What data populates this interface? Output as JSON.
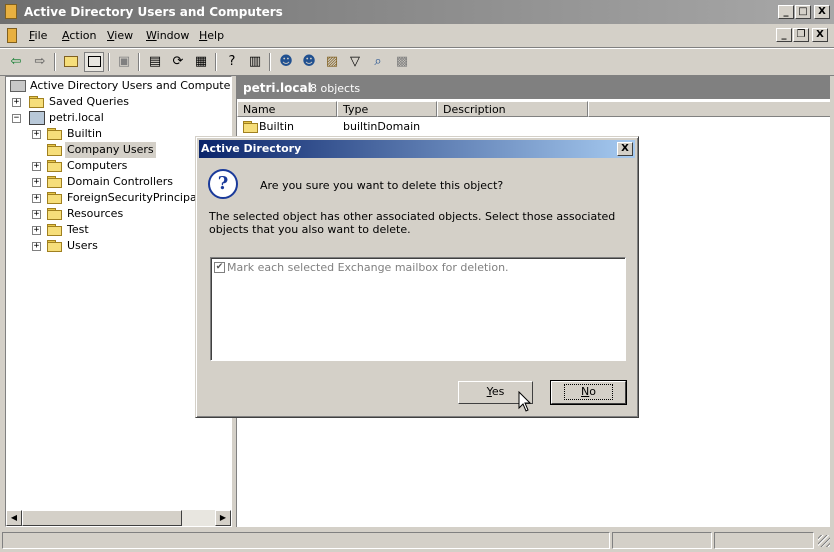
{
  "window": {
    "title": "Active Directory Users and Computers",
    "controls": {
      "minimize": "_",
      "maximize": "□",
      "close": "X",
      "restore": "❐"
    }
  },
  "menubar": {
    "items": [
      {
        "label": "File",
        "accel": "F",
        "rest": "ile"
      },
      {
        "label": "Action",
        "accel": "A",
        "rest": "ction"
      },
      {
        "label": "View",
        "accel": "V",
        "rest": "iew"
      },
      {
        "label": "Window",
        "accel": "W",
        "rest": "indow"
      },
      {
        "label": "Help",
        "accel": "H",
        "rest": "elp"
      }
    ]
  },
  "toolbar": {
    "icons": [
      "back-icon",
      "forward-icon",
      "up-folder-icon",
      "show-hide-tree-icon",
      "delete-icon",
      "properties-icon",
      "refresh-icon",
      "export-list-icon",
      "help-icon",
      "console-icon",
      "new-user-icon",
      "new-group-icon",
      "new-ou-icon",
      "filter-icon",
      "find-icon",
      "add-to-group-icon"
    ]
  },
  "tree": {
    "root": "Active Directory Users and Computers [ze",
    "items": [
      {
        "label": "Saved Queries",
        "level": 1
      },
      {
        "label": "petri.local",
        "level": 1
      },
      {
        "label": "Builtin",
        "level": 2
      },
      {
        "label": "Company Users",
        "level": 2
      },
      {
        "label": "Computers",
        "level": 2
      },
      {
        "label": "Domain Controllers",
        "level": 2
      },
      {
        "label": "ForeignSecurityPrincipals",
        "level": 2
      },
      {
        "label": "Resources",
        "level": 2
      },
      {
        "label": "Test",
        "level": 2
      },
      {
        "label": "Users",
        "level": 2
      }
    ]
  },
  "rightpane": {
    "domain": "petri.local",
    "count": "8 objects",
    "columns": [
      "Name",
      "Type",
      "Description"
    ],
    "rows": [
      {
        "name": "Builtin",
        "type": "builtinDomain",
        "description": ""
      }
    ]
  },
  "dialog": {
    "title": "Active Directory",
    "question": "Are you sure you want to delete this object?",
    "info": "The selected object has other associated objects. Select those associated objects that you also want to delete.",
    "checkbox_label": "Mark each selected Exchange mailbox for deletion.",
    "checkbox_checked": true,
    "yes_label": "Yes",
    "yes_accel": "Y",
    "yes_rest": "es",
    "no_label": "No",
    "no_accel": "N",
    "no_rest": "o"
  }
}
